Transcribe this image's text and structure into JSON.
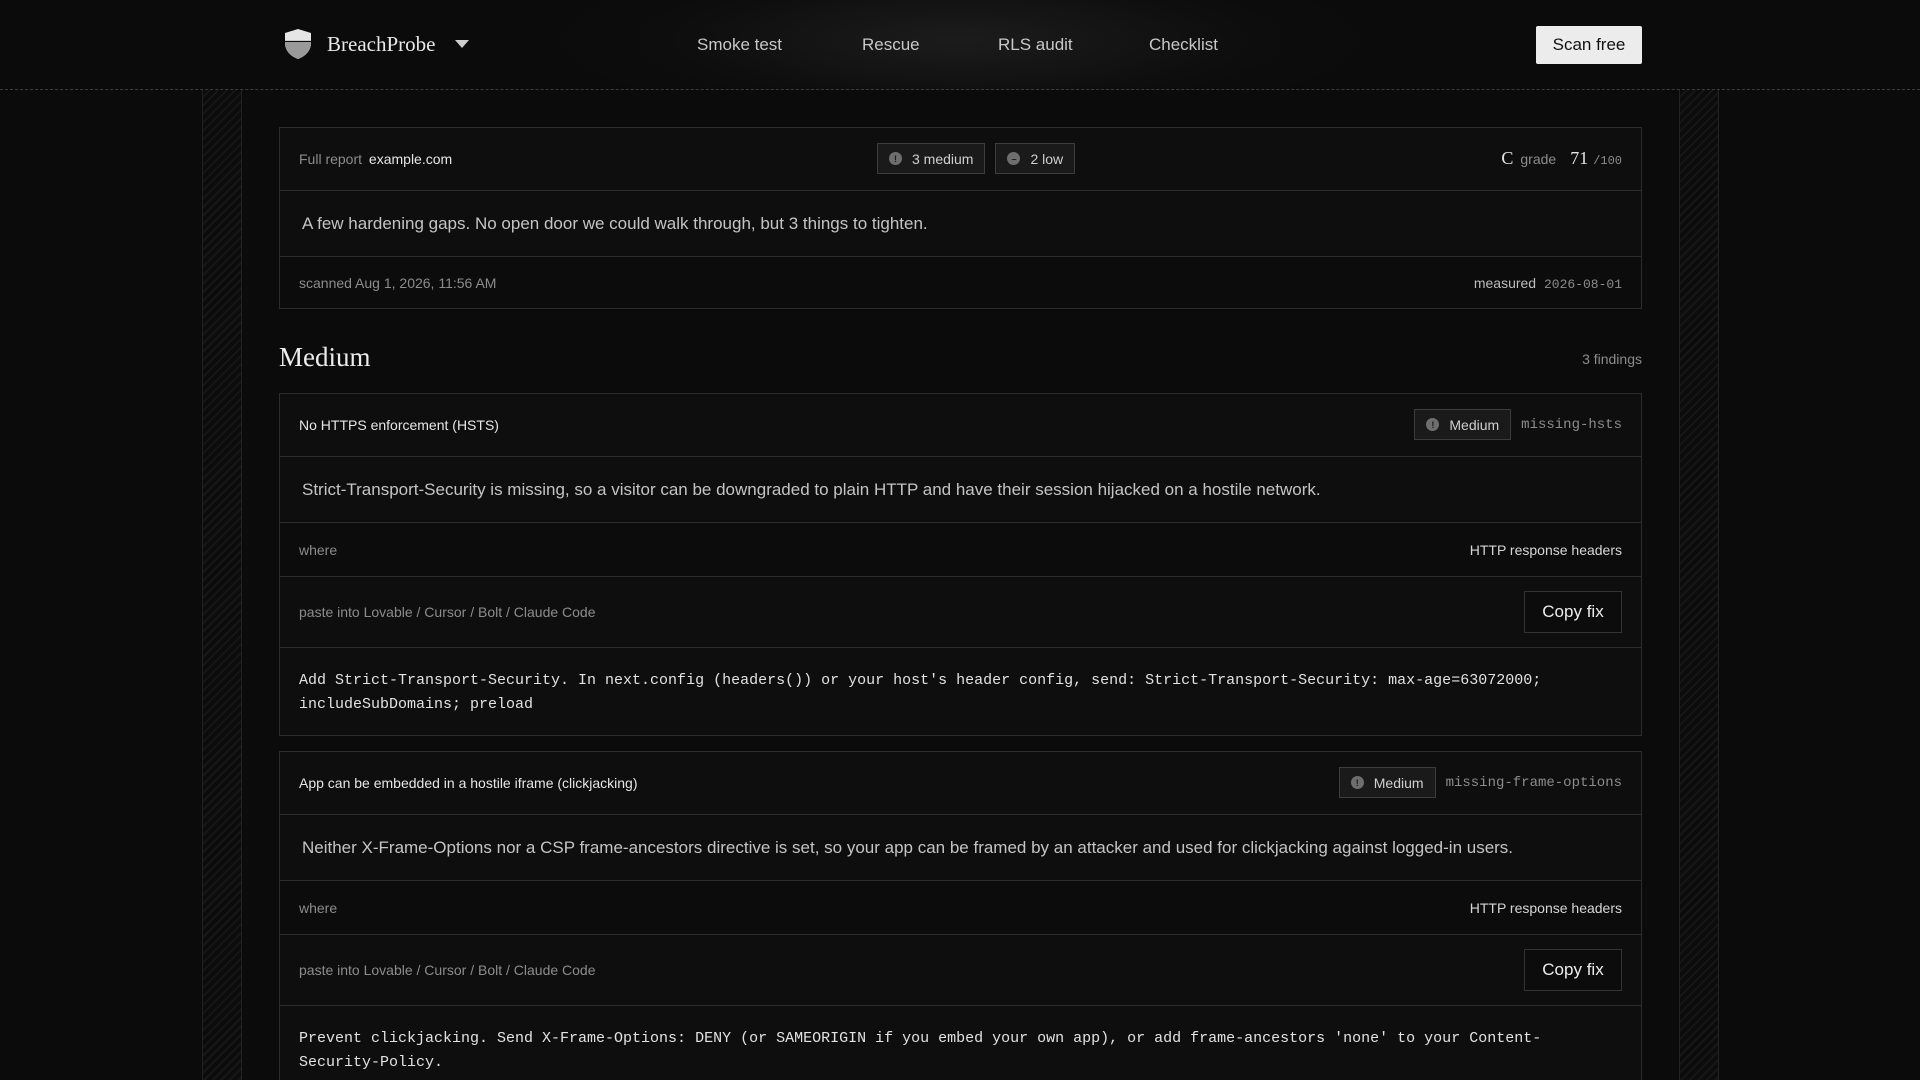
{
  "header": {
    "brand": "BreachProbe",
    "nav": [
      "Smoke test",
      "Rescue",
      "RLS audit",
      "Checklist"
    ],
    "cta": "Scan free"
  },
  "report": {
    "label": "Full report",
    "domain": "example.com",
    "badges": [
      "3 medium",
      "2 low"
    ],
    "grade_letter": "C",
    "grade_label": "grade",
    "score": "71",
    "score_max": "/100",
    "summary": "A few hardening gaps. No open door we could walk through, but 3 things to tighten.",
    "scanned": "scanned Aug 1, 2026, 11:56 AM",
    "measured_label": "measured",
    "measured_date": "2026-08-01"
  },
  "section": {
    "title": "Medium",
    "count": "3 findings"
  },
  "findings": [
    {
      "title": "No HTTPS enforcement (HSTS)",
      "severity": "Medium",
      "id": "missing-hsts",
      "description": "Strict-Transport-Security is missing, so a visitor can be downgraded to plain HTTP and have their session hijacked on a hostile network.",
      "where_label": "where",
      "where_value": "HTTP response headers",
      "paste_label": "paste into Lovable / Cursor / Bolt / Claude Code",
      "copy_label": "Copy fix",
      "fix": "Add Strict-Transport-Security. In next.config (headers()) or your host's header config, send: Strict-Transport-Security: max-age=63072000; includeSubDomains; preload"
    },
    {
      "title": "App can be embedded in a hostile iframe (clickjacking)",
      "severity": "Medium",
      "id": "missing-frame-options",
      "description": "Neither X-Frame-Options nor a CSP frame-ancestors directive is set, so your app can be framed by an attacker and used for clickjacking against logged-in users.",
      "where_label": "where",
      "where_value": "HTTP response headers",
      "paste_label": "paste into Lovable / Cursor / Bolt / Claude Code",
      "copy_label": "Copy fix",
      "fix": "Prevent clickjacking. Send X-Frame-Options: DENY (or SAMEORIGIN if you embed your own app), or add frame-ancestors 'none' to your Content-Security-Policy."
    }
  ]
}
